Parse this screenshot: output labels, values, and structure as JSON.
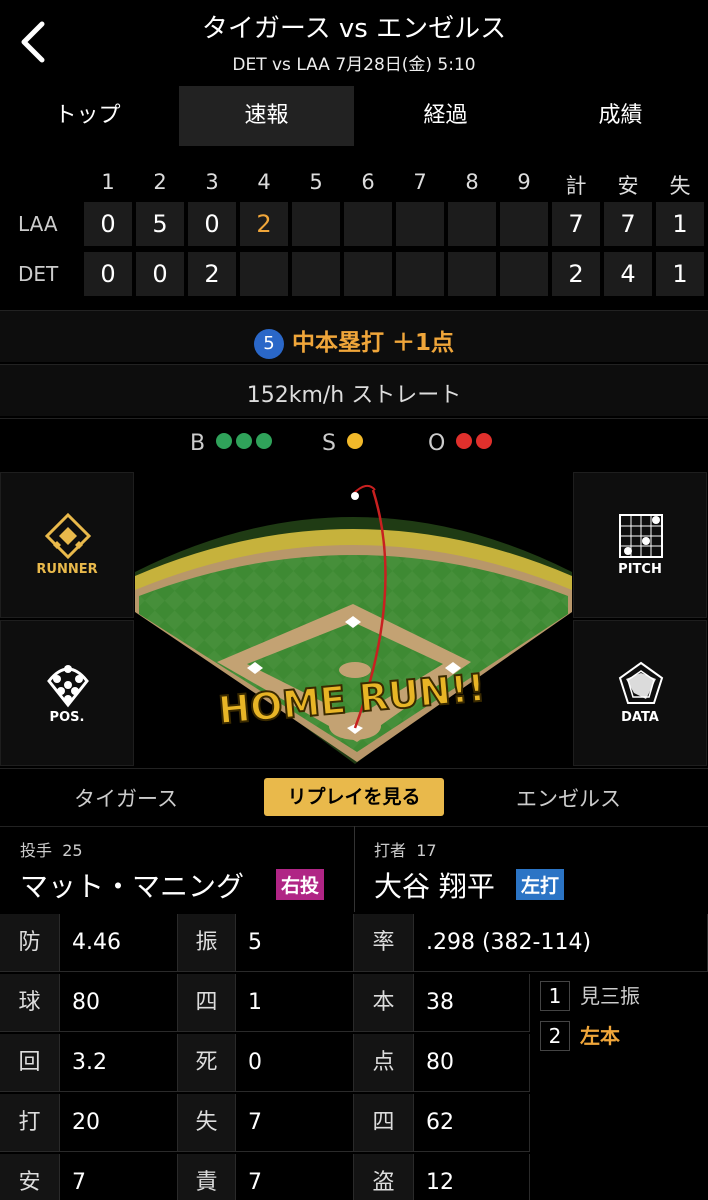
{
  "header": {
    "title": "タイガース vs エンゼルス",
    "subtitle": "DET vs LAA 7月28日(金) 5:10"
  },
  "tabs": [
    "トップ",
    "速報",
    "経過",
    "成績"
  ],
  "scoreboard": {
    "columns": [
      "1",
      "2",
      "3",
      "4",
      "5",
      "6",
      "7",
      "8",
      "9",
      "計",
      "安",
      "失"
    ],
    "rows": [
      {
        "team": "LAA",
        "cells": [
          "0",
          "5",
          "0",
          "2",
          "",
          "",
          "",
          "",
          "",
          "7",
          "7",
          "1"
        ]
      },
      {
        "team": "DET",
        "cells": [
          "0",
          "0",
          "2",
          "",
          "",
          "",
          "",
          "",
          "",
          "2",
          "4",
          "1"
        ]
      }
    ],
    "highlight_color": "#f0a63a"
  },
  "event": {
    "number": "5",
    "text": "中本塁打 ＋1点"
  },
  "pitch": {
    "text": "152km/h ストレート"
  },
  "count": {
    "b_label": "B",
    "s_label": "S",
    "o_label": "O",
    "balls": 3,
    "strikes": 1,
    "outs": 2
  },
  "side_buttons": {
    "runner": "RUNNER",
    "pitch": "PITCH",
    "pos": "POS.",
    "data": "DATA"
  },
  "field": {
    "banner": "HOME RUN!!"
  },
  "teambar": {
    "home": "タイガース",
    "replay": "リプレイを見る",
    "away": "エンゼルス"
  },
  "pitcher": {
    "label": "投手",
    "number": "25",
    "name": "マット・マニング",
    "hand": "右投"
  },
  "batter": {
    "label": "打者",
    "number": "17",
    "name": "大谷 翔平",
    "hand": "左打"
  },
  "pitcher_stats": [
    {
      "k1": "防",
      "v1": "4.46",
      "k2": "振",
      "v2": "5"
    },
    {
      "k1": "球",
      "v1": "80",
      "k2": "四",
      "v2": "1"
    },
    {
      "k1": "回",
      "v1": "3.2",
      "k2": "死",
      "v2": "0"
    },
    {
      "k1": "打",
      "v1": "20",
      "k2": "失",
      "v2": "7"
    },
    {
      "k1": "安",
      "v1": "7",
      "k2": "責",
      "v2": "7"
    }
  ],
  "batter_stats": [
    {
      "k": "率",
      "v": ".298 (382-114)"
    },
    {
      "k": "本",
      "v": "38"
    },
    {
      "k": "点",
      "v": "80"
    },
    {
      "k": "四",
      "v": "62"
    },
    {
      "k": "盗",
      "v": "12"
    }
  ],
  "at_bats": [
    {
      "n": "1",
      "result": "見三振"
    },
    {
      "n": "2",
      "result": "左本"
    }
  ]
}
